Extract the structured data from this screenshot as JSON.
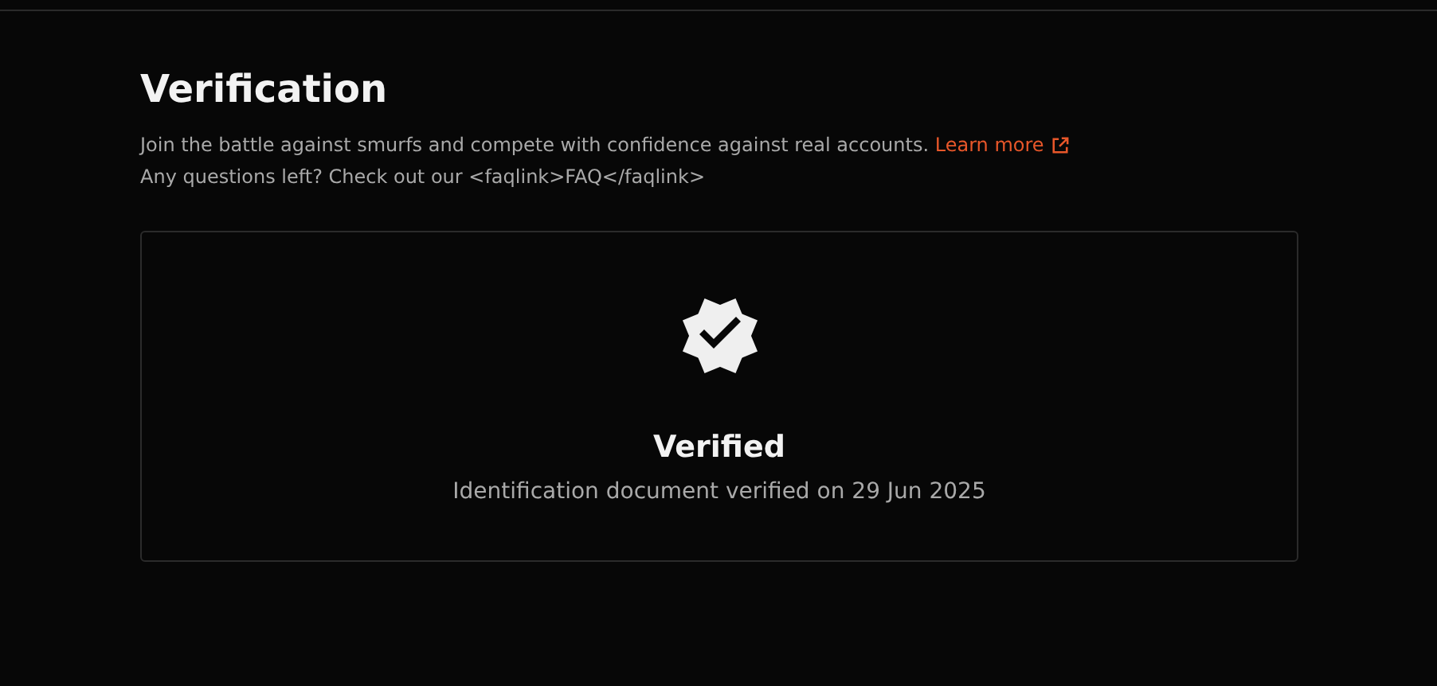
{
  "title": "Verification",
  "description": {
    "text": "Join the battle against smurfs and compete with confidence against real accounts.",
    "link": "Learn more"
  },
  "faq_line": "Any questions left? Check out our <faqlink>FAQ</faqlink>",
  "status_card": {
    "heading": "Verified",
    "detail": "Identification document verified on 29 Jun 2025"
  }
}
